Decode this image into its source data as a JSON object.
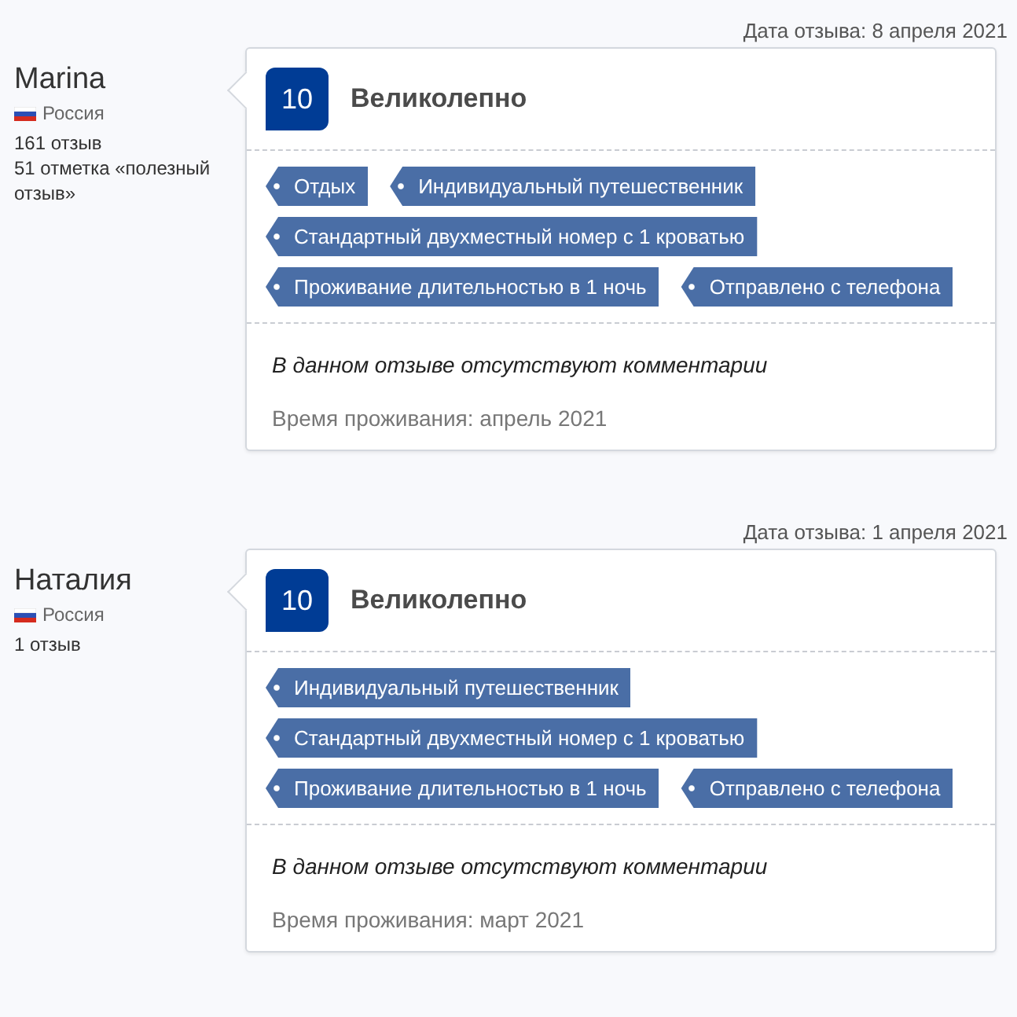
{
  "reviews": [
    {
      "date": "Дата отзыва: 8 апреля 2021",
      "reviewer": {
        "name": "Marina",
        "country": "Россия",
        "stats": [
          "161 отзыв",
          "51 отметка «полезный отзыв»"
        ]
      },
      "score": "10",
      "verdict": "Великолепно",
      "tag_rows": [
        [
          "Отдых",
          "Индивидуальный путешественник"
        ],
        [
          "Стандартный двухместный номер с 1 кроватью"
        ],
        [
          "Проживание длительностью в 1 ночь",
          "Отправлено с телефона"
        ]
      ],
      "comment": "В данном отзыве отсутствуют комментарии",
      "stay": "Время проживания: апрель 2021"
    },
    {
      "date": "Дата отзыва: 1 апреля 2021",
      "reviewer": {
        "name": "Наталия",
        "country": "Россия",
        "stats": [
          "1 отзыв"
        ]
      },
      "score": "10",
      "verdict": "Великолепно",
      "tag_rows": [
        [
          "Индивидуальный путешественник"
        ],
        [
          "Стандартный двухместный номер с 1 кроватью"
        ],
        [
          "Проживание длительностью в 1 ночь",
          "Отправлено с телефона"
        ]
      ],
      "comment": "В данном отзыве отсутствуют комментарии",
      "stay": "Время проживания: март 2021"
    }
  ]
}
